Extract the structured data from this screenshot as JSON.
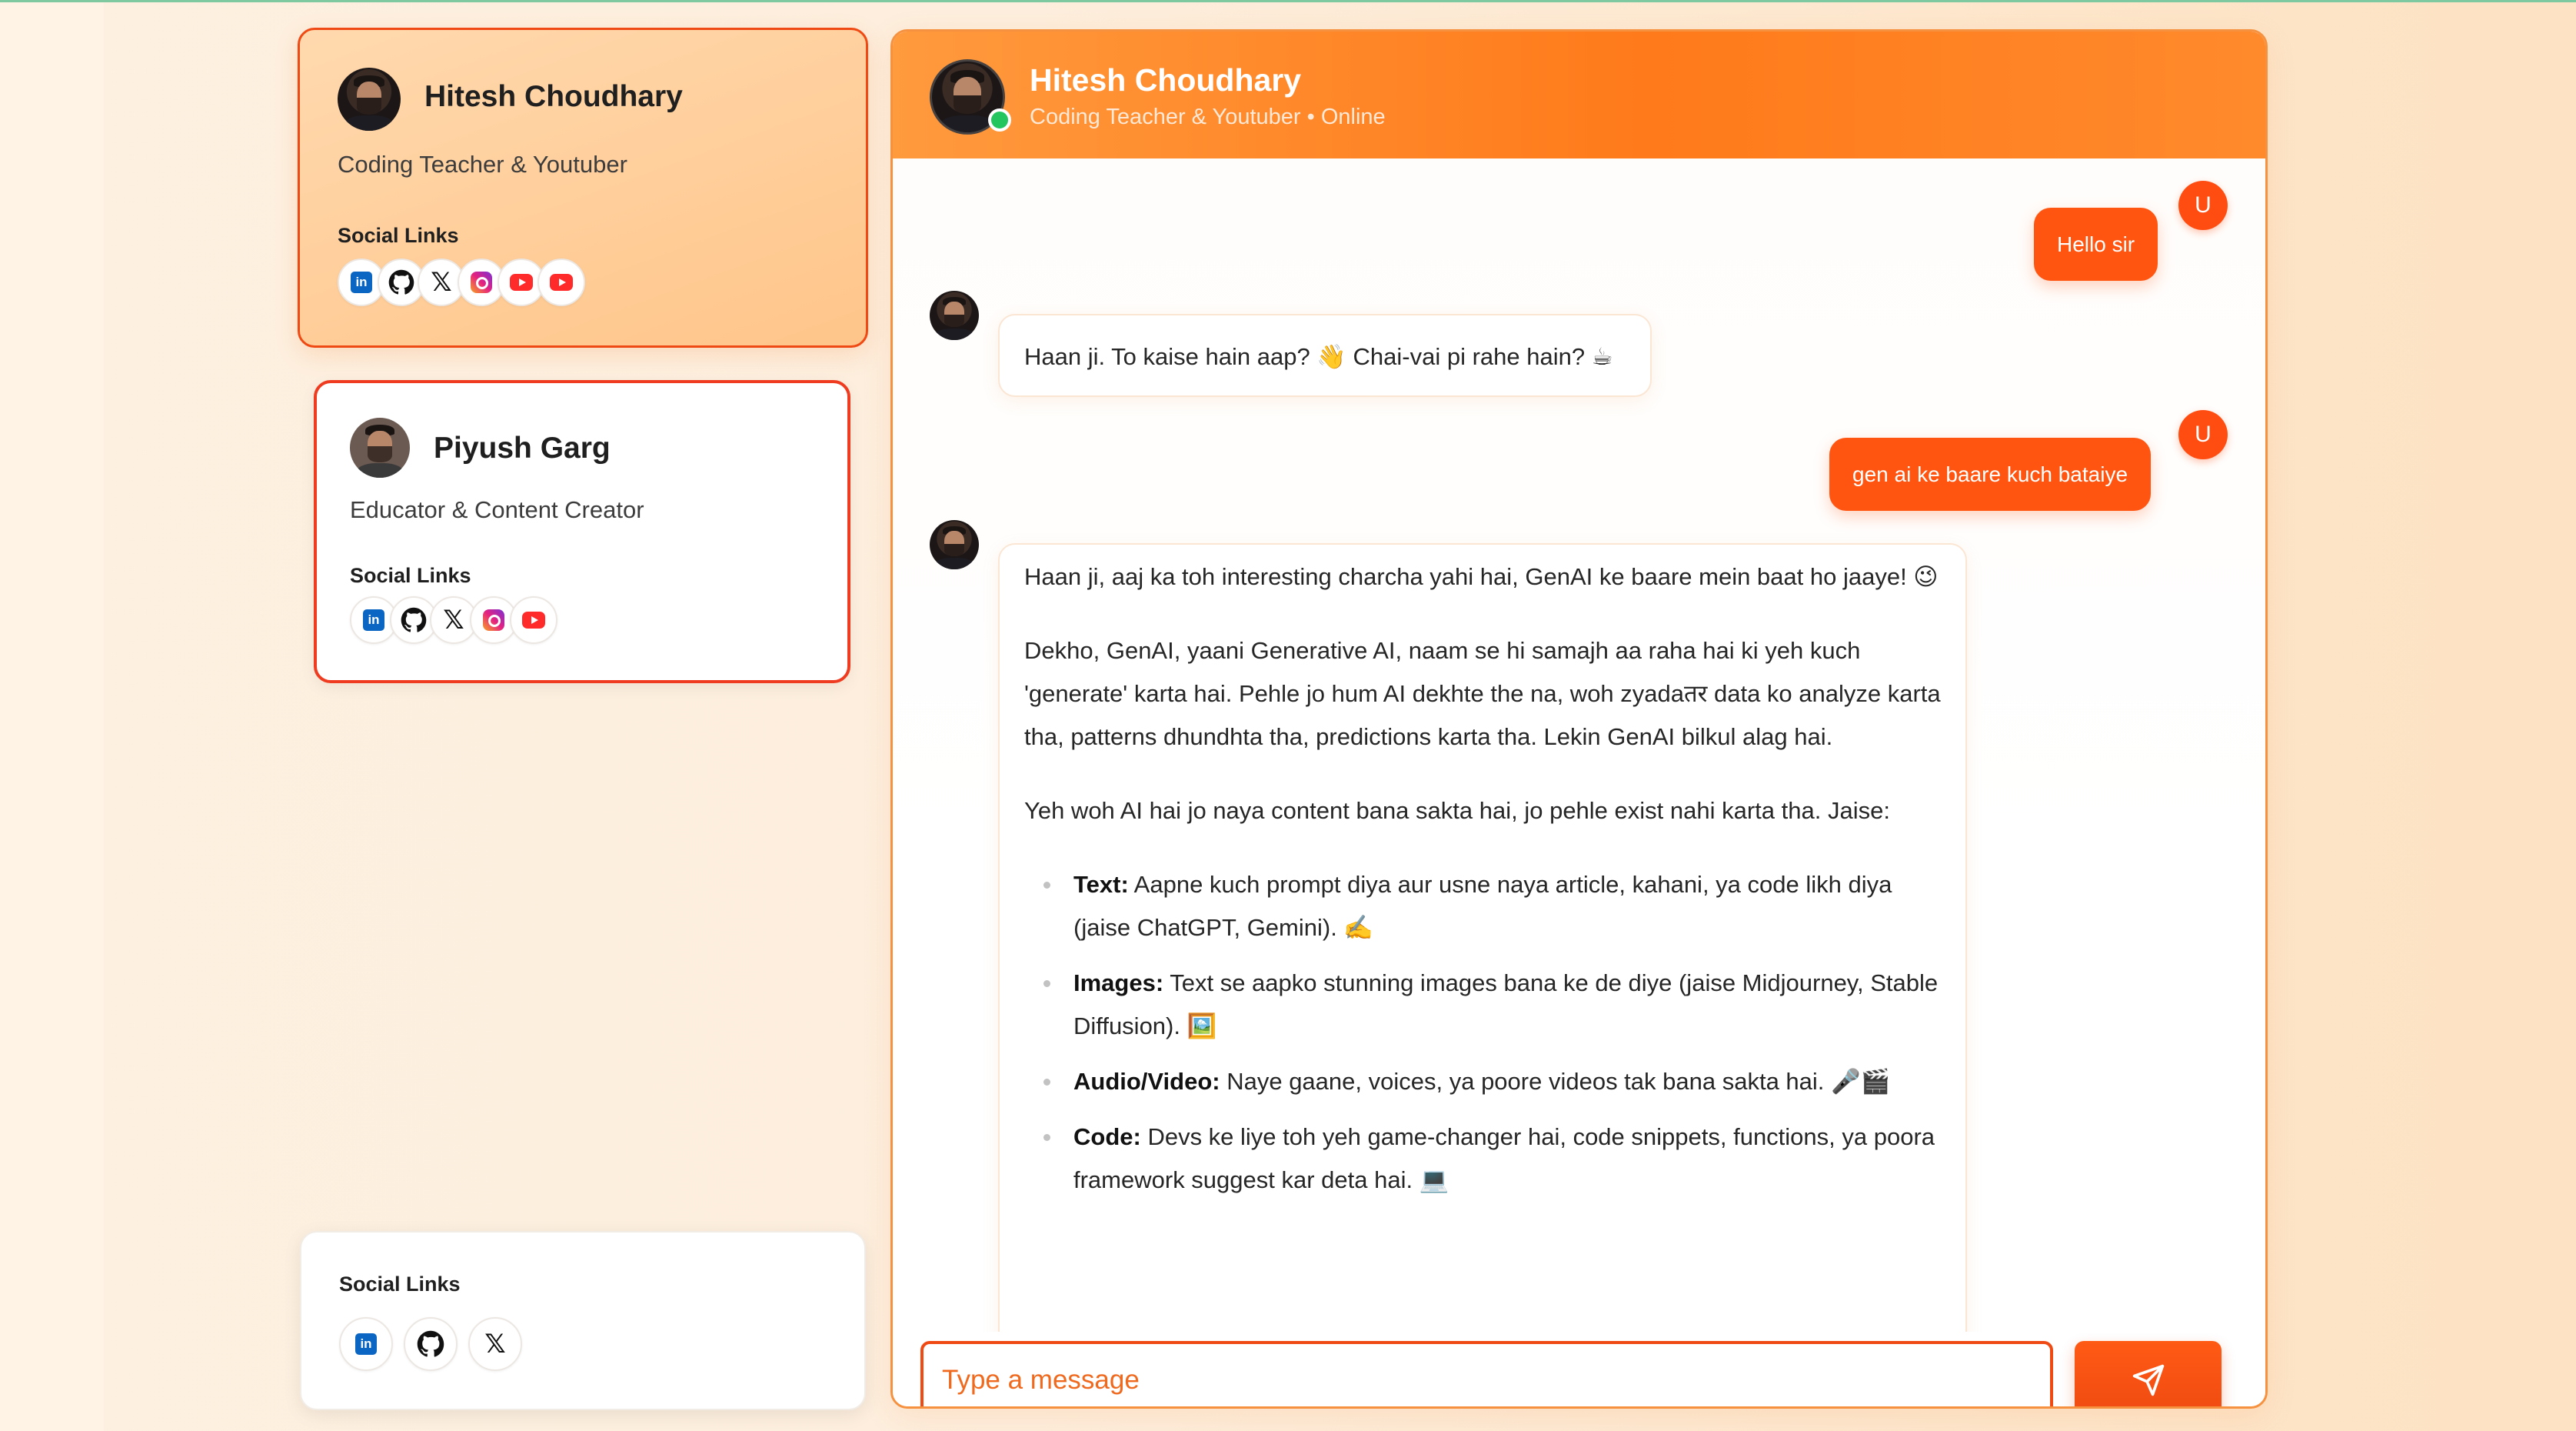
{
  "personas": [
    {
      "name": "Hitesh Choudhary",
      "role": "Coding Teacher & Youtuber",
      "social_title": "Social Links",
      "socials": [
        "linkedin-icon",
        "github-icon",
        "x-icon",
        "instagram-icon",
        "youtube-icon",
        "youtube-icon"
      ]
    },
    {
      "name": "Piyush Garg",
      "role": "Educator & Content Creator",
      "social_title": "Social Links",
      "socials": [
        "linkedin-icon",
        "github-icon",
        "x-icon",
        "instagram-icon",
        "youtube-icon"
      ]
    }
  ],
  "bottom_card": {
    "social_title": "Social Links",
    "socials": [
      "linkedin-icon",
      "github-icon",
      "x-icon"
    ]
  },
  "chat": {
    "title": "Hitesh Choudhary",
    "subtitle": "Coding Teacher & Youtuber • Online",
    "user_initial": "U",
    "messages": {
      "m1": "Hello sir",
      "m2": "Haan ji. To kaise hain aap? 👋 Chai-vai pi rahe hain? ☕",
      "m3": "gen ai ke baare kuch bataiye",
      "m4": {
        "p1": "Haan ji, aaj ka toh interesting charcha yahi hai, GenAI ke baare mein baat ho jaaye! 😉",
        "p2": "Dekho, GenAI, yaani Generative AI, naam se hi samajh aa raha hai ki yeh kuch 'generate' karta hai. Pehle jo hum AI dekhte the na, woh zyadaतर data ko analyze karta tha, patterns dhundhta tha, predictions karta tha. Lekin GenAI bilkul alag hai.",
        "p3": "Yeh woh AI hai jo naya content bana sakta hai, jo pehle exist nahi karta tha. Jaise:",
        "items": [
          {
            "label": "Text:",
            "text": " Aapne kuch prompt diya aur usne naya article, kahani, ya code likh diya (jaise ChatGPT, Gemini). ✍️"
          },
          {
            "label": "Images:",
            "text": " Text se aapko stunning images bana ke de diye (jaise Midjourney, Stable Diffusion). 🖼️"
          },
          {
            "label": "Audio/Video:",
            "text": " Naye gaane, voices, ya poore videos tak bana sakta hai. 🎤🎬"
          },
          {
            "label": "Code:",
            "text": " Devs ke liye toh yeh game-changer hai, code snippets, functions, ya poora framework suggest kar deta hai. 💻"
          }
        ]
      }
    },
    "input_placeholder": "Type a message",
    "send_icon": "send-icon"
  },
  "colors": {
    "accent": "#ff5510",
    "header": "#ff7a1a",
    "online": "#22c55e"
  }
}
